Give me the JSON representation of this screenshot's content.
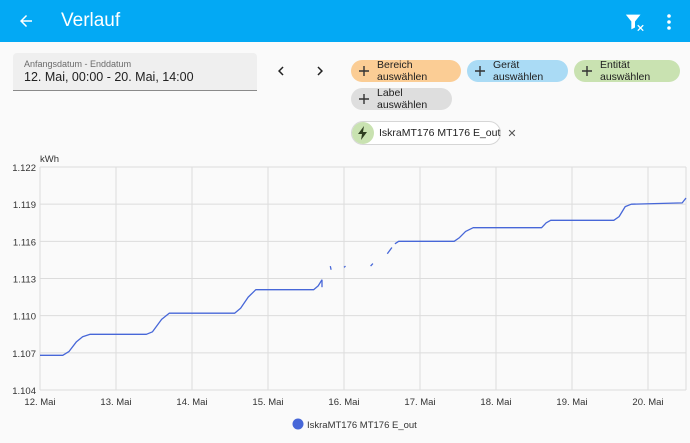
{
  "header": {
    "title": "Verlauf",
    "back_icon": "arrow-left-icon",
    "filter_icon": "filter-remove-icon",
    "menu_icon": "dots-vertical-icon",
    "background": "#03a9f4"
  },
  "date_picker": {
    "label": "Anfangsdatum - Enddatum",
    "value": "12. Mai, 00:00 - 20. Mai, 14:00"
  },
  "chips": {
    "area": "Bereich auswählen",
    "device": "Gerät auswählen",
    "entity": "Entität auswählen",
    "label": "Label auswählen"
  },
  "selected_entity": {
    "name": "IskraMT176 MT176 E_out",
    "icon": "lightning-bolt-icon"
  },
  "chart_data": {
    "type": "line",
    "ylabel": "kWh",
    "xlabel": "",
    "ylim": [
      1.104,
      1.122
    ],
    "y_ticks": [
      "1.104",
      "1.107",
      "1.110",
      "1.113",
      "1.116",
      "1.119",
      "1.122"
    ],
    "x_range": [
      12,
      20.5
    ],
    "categories": [
      "12. Mai",
      "13. Mai",
      "14. Mai",
      "15. Mai",
      "16. Mai",
      "17. Mai",
      "18. Mai",
      "19. Mai",
      "20. Mai"
    ],
    "grid": true,
    "legend_position": "bottom",
    "series": [
      {
        "name": "IskraMT176 MT176 E_out",
        "color": "#4767d8",
        "segments": [
          [
            [
              12.0,
              1.1068
            ],
            [
              12.3,
              1.1068
            ],
            [
              12.38,
              1.1071
            ],
            [
              12.48,
              1.1079
            ],
            [
              12.56,
              1.1083
            ],
            [
              12.66,
              1.1085
            ],
            [
              13.4,
              1.1085
            ],
            [
              13.48,
              1.1087
            ],
            [
              13.6,
              1.1097
            ],
            [
              13.7,
              1.1102
            ],
            [
              14.56,
              1.1102
            ],
            [
              14.64,
              1.1106
            ],
            [
              14.74,
              1.1115
            ],
            [
              14.84,
              1.1121
            ],
            [
              15.6,
              1.1121
            ],
            [
              15.66,
              1.1124
            ],
            [
              15.71,
              1.1129
            ]
          ],
          [
            [
              15.71,
              1.1123
            ],
            [
              15.71,
              1.1129
            ]
          ],
          [
            [
              15.82,
              1.114
            ],
            [
              15.83,
              1.1137
            ]
          ],
          [
            [
              16.0,
              1.1139
            ],
            [
              16.02,
              1.114
            ]
          ],
          [
            [
              16.35,
              1.114
            ],
            [
              16.38,
              1.1142
            ]
          ],
          [
            [
              16.57,
              1.115
            ],
            [
              16.63,
              1.1155
            ]
          ],
          [
            [
              16.67,
              1.1158
            ],
            [
              16.72,
              1.116
            ],
            [
              17.45,
              1.116
            ],
            [
              17.52,
              1.1163
            ],
            [
              17.6,
              1.1168
            ],
            [
              17.7,
              1.1171
            ],
            [
              18.6,
              1.1171
            ],
            [
              18.66,
              1.1175
            ],
            [
              18.72,
              1.1177
            ],
            [
              19.55,
              1.1177
            ],
            [
              19.62,
              1.118
            ],
            [
              19.7,
              1.1188
            ],
            [
              19.78,
              1.119
            ],
            [
              20.45,
              1.1191
            ],
            [
              20.5,
              1.1195
            ]
          ]
        ]
      }
    ]
  }
}
